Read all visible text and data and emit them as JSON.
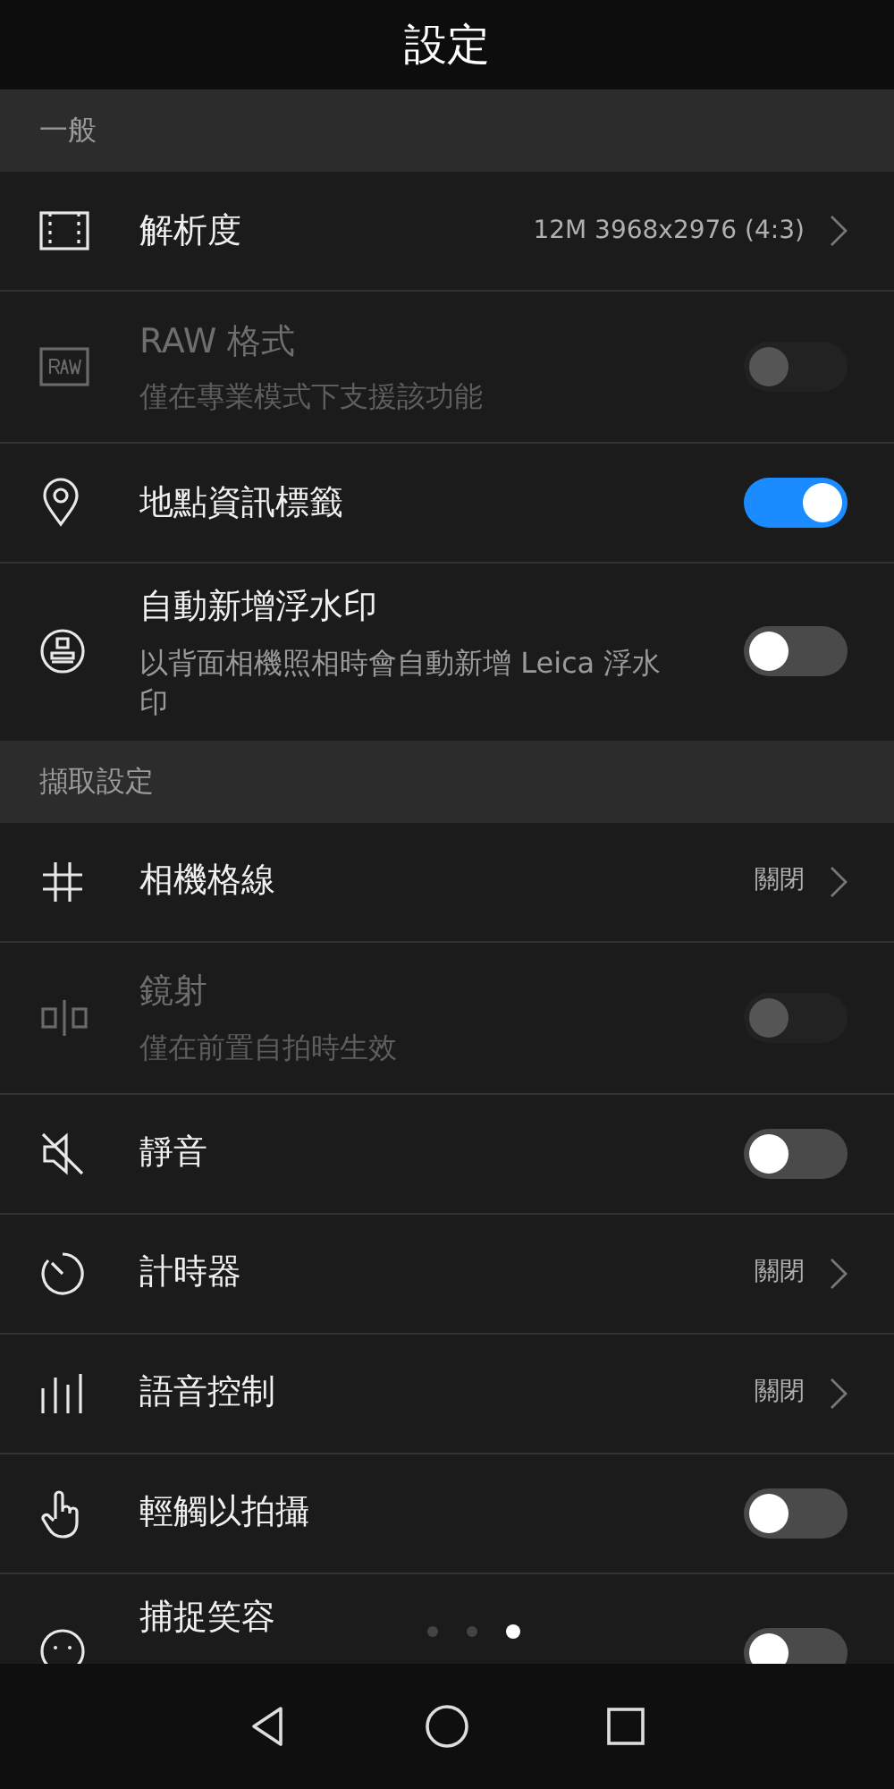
{
  "title": "設定",
  "sections": [
    {
      "header": "一般",
      "rows": [
        {
          "kind": "link",
          "title": "解析度",
          "value": "12M 3968x2976 (4:3)",
          "disabled": false
        },
        {
          "kind": "toggle",
          "title": "RAW 格式",
          "subtitle": "僅在專業模式下支援該功能",
          "on": false,
          "disabled": true
        },
        {
          "kind": "toggle",
          "title": "地點資訊標籤",
          "on": true,
          "disabled": false
        },
        {
          "kind": "toggle",
          "title": "自動新增浮水印",
          "subtitle": "以背面相機照相時會自動新增 Leica 浮水印",
          "on": false,
          "disabled": false
        }
      ]
    },
    {
      "header": "擷取設定",
      "rows": [
        {
          "kind": "link",
          "title": "相機格線",
          "value": "關閉",
          "disabled": false
        },
        {
          "kind": "toggle",
          "title": "鏡射",
          "subtitle": "僅在前置自拍時生效",
          "on": false,
          "disabled": true
        },
        {
          "kind": "toggle",
          "title": "靜音",
          "on": false,
          "disabled": false
        },
        {
          "kind": "link",
          "title": "計時器",
          "value": "關閉",
          "disabled": false
        },
        {
          "kind": "link",
          "title": "語音控制",
          "value": "關閉",
          "disabled": false
        },
        {
          "kind": "toggle",
          "title": "輕觸以拍攝",
          "on": false,
          "disabled": false
        },
        {
          "kind": "toggle",
          "title": "捕捉笑容",
          "on": false,
          "disabled": false
        }
      ]
    }
  ],
  "page_indicator": [
    {
      "selected": false
    },
    {
      "selected": false
    },
    {
      "selected": true
    }
  ]
}
